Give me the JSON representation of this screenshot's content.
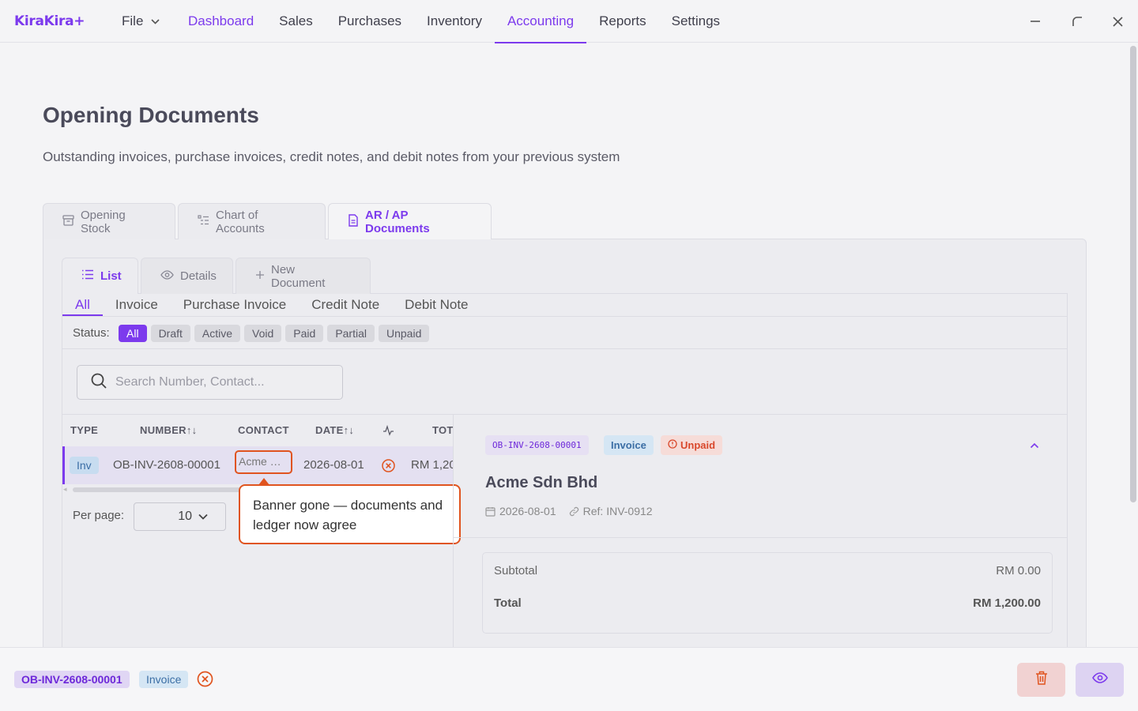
{
  "app": {
    "logo": "KiraKira+"
  },
  "menu": {
    "file_label": "File"
  },
  "nav": [
    {
      "label": "Dashboard"
    },
    {
      "label": "Sales"
    },
    {
      "label": "Purchases"
    },
    {
      "label": "Inventory"
    },
    {
      "label": "Accounting"
    },
    {
      "label": "Reports"
    },
    {
      "label": "Settings"
    }
  ],
  "page": {
    "title": "Opening Documents",
    "subtitle": "Outstanding invoices, purchase invoices, credit notes, and debit notes from your previous system"
  },
  "outer_tabs": [
    {
      "label": "Opening Stock",
      "icon": "archive-icon"
    },
    {
      "label": "Chart of Accounts",
      "icon": "list-tree-icon"
    },
    {
      "label": "AR / AP Documents",
      "icon": "document-icon"
    }
  ],
  "inner_tabs": [
    {
      "label": "List",
      "icon": "list-icon"
    },
    {
      "label": "Details",
      "icon": "eye-icon"
    },
    {
      "label": "New Document",
      "icon": "plus-icon"
    }
  ],
  "doc_types": [
    "All",
    "Invoice",
    "Purchase Invoice",
    "Credit Note",
    "Debit Note"
  ],
  "status": {
    "label": "Status:",
    "chips": [
      "All",
      "Draft",
      "Active",
      "Void",
      "Paid",
      "Partial",
      "Unpaid"
    ]
  },
  "search": {
    "placeholder": "Search Number, Contact..."
  },
  "table": {
    "headers": [
      "TYPE",
      "NUMBER↑↓",
      "CONTACT",
      "DATE↑↓",
      "TOT"
    ],
    "rows": [
      {
        "type": "Inv",
        "number": "OB-INV-2608-00001",
        "contact": "Acme …",
        "date": "2026-08-01",
        "total": "RM 1,20"
      }
    ]
  },
  "pagination": {
    "label": "Per page:",
    "value": "10"
  },
  "callout": {
    "text": "Banner gone — documents and ledger now agree"
  },
  "detail": {
    "number": "OB-INV-2608-00001",
    "type": "Invoice",
    "status": "Unpaid",
    "contact": "Acme Sdn Bhd",
    "date": "2026-08-01",
    "ref": "Ref: INV-0912",
    "subtotal_label": "Subtotal",
    "subtotal": "RM 0.00",
    "total_label": "Total",
    "total": "RM 1,200.00"
  },
  "bottom": {
    "number": "OB-INV-2608-00001",
    "type": "Invoice"
  },
  "colors": {
    "accent": "#7c3aed",
    "danger": "#e0541f",
    "info": "#3b6ea5"
  }
}
